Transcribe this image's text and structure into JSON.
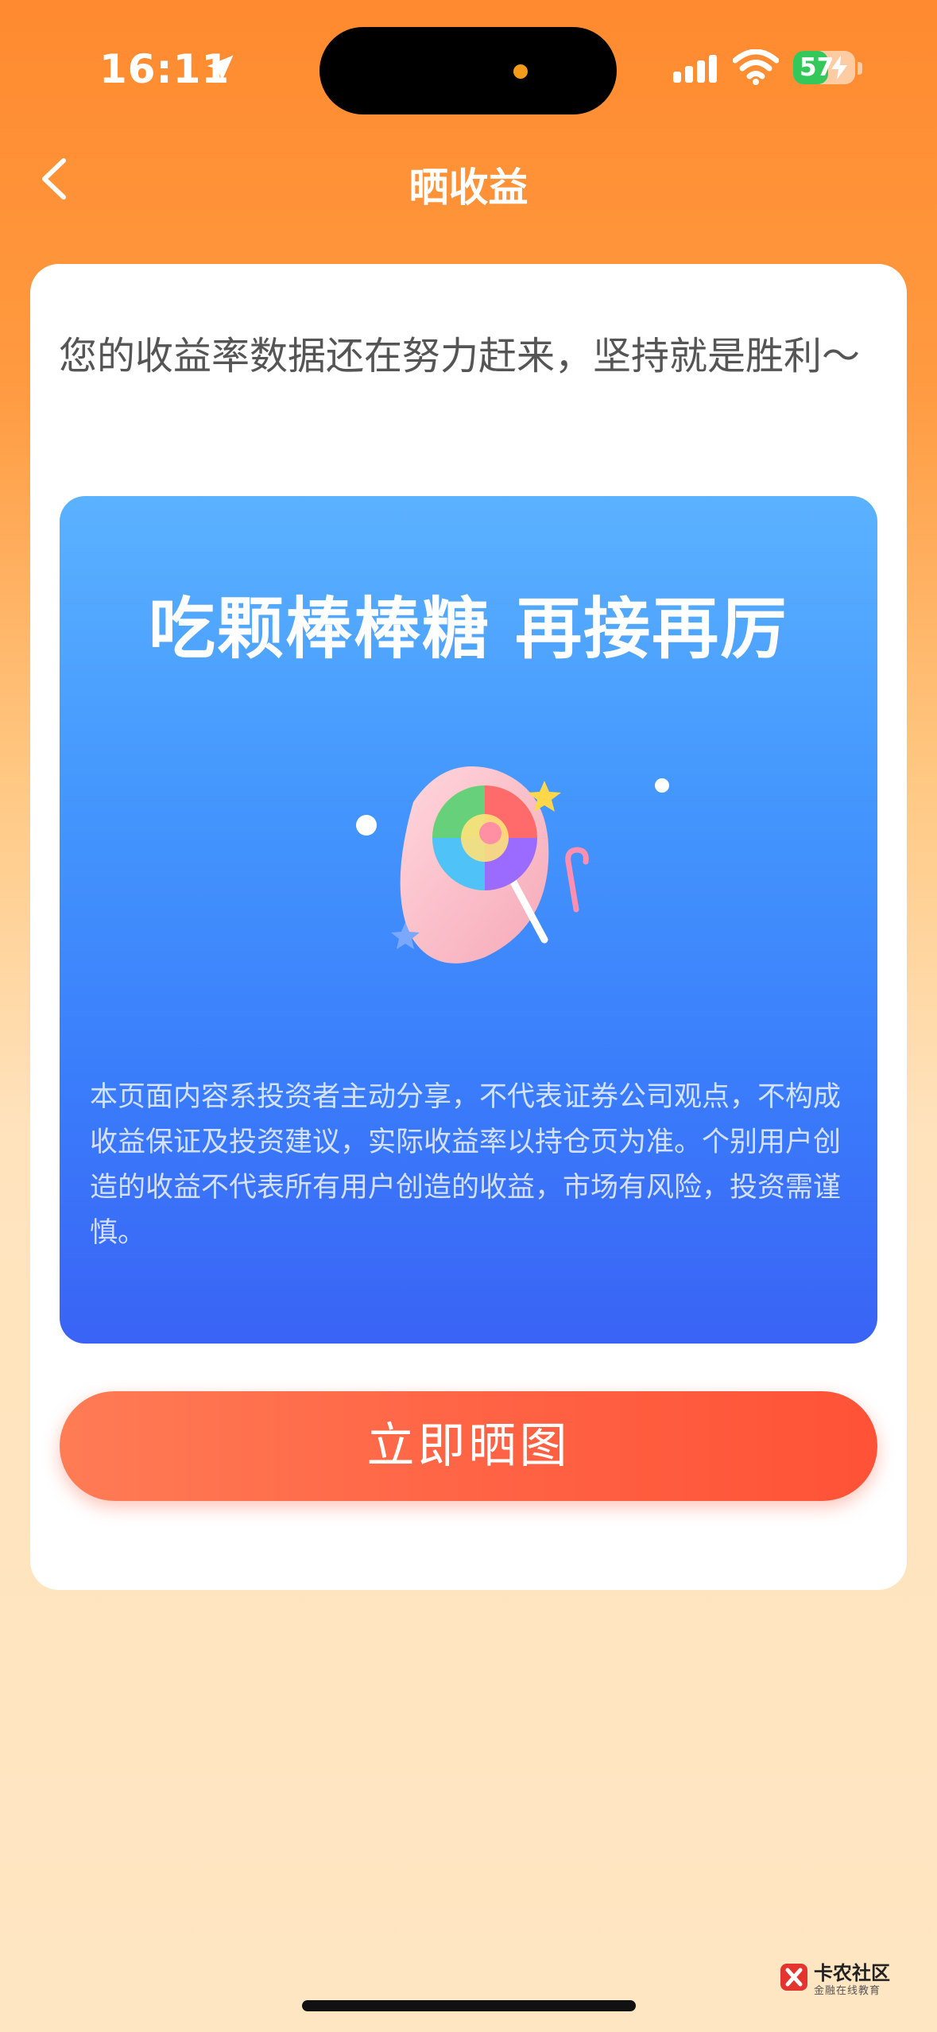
{
  "status_bar": {
    "time": "16:11",
    "battery_level": "57",
    "icons": [
      "location-arrow-icon",
      "signal-icon",
      "wifi-icon",
      "battery-icon"
    ]
  },
  "nav": {
    "title": "晒收益",
    "back_icon": "chevron-left-icon"
  },
  "card": {
    "message": "您的收益率数据还在努力赶来，坚持就是胜利～",
    "panel": {
      "headline": "吃颗棒棒糖 再接再厉",
      "illustration": "lollipop-illustration",
      "disclaimer": "本页面内容系投资者主动分享，不代表证券公司观点，不构成收益保证及投资建议，实际收益率以持仓页为准。个别用户创造的收益不代表所有用户创造的收益，市场有风险，投资需谨慎。"
    },
    "button_label": "立即晒图"
  },
  "watermark": {
    "title": "卡农社区",
    "subtitle": "金融在线教育"
  },
  "colors": {
    "header_orange": "#ff8a2f",
    "background_cream": "#ffe6c2",
    "panel_blue_top": "#5bb2ff",
    "panel_blue_bottom": "#3a63f5",
    "button_red": "#ff5236"
  }
}
